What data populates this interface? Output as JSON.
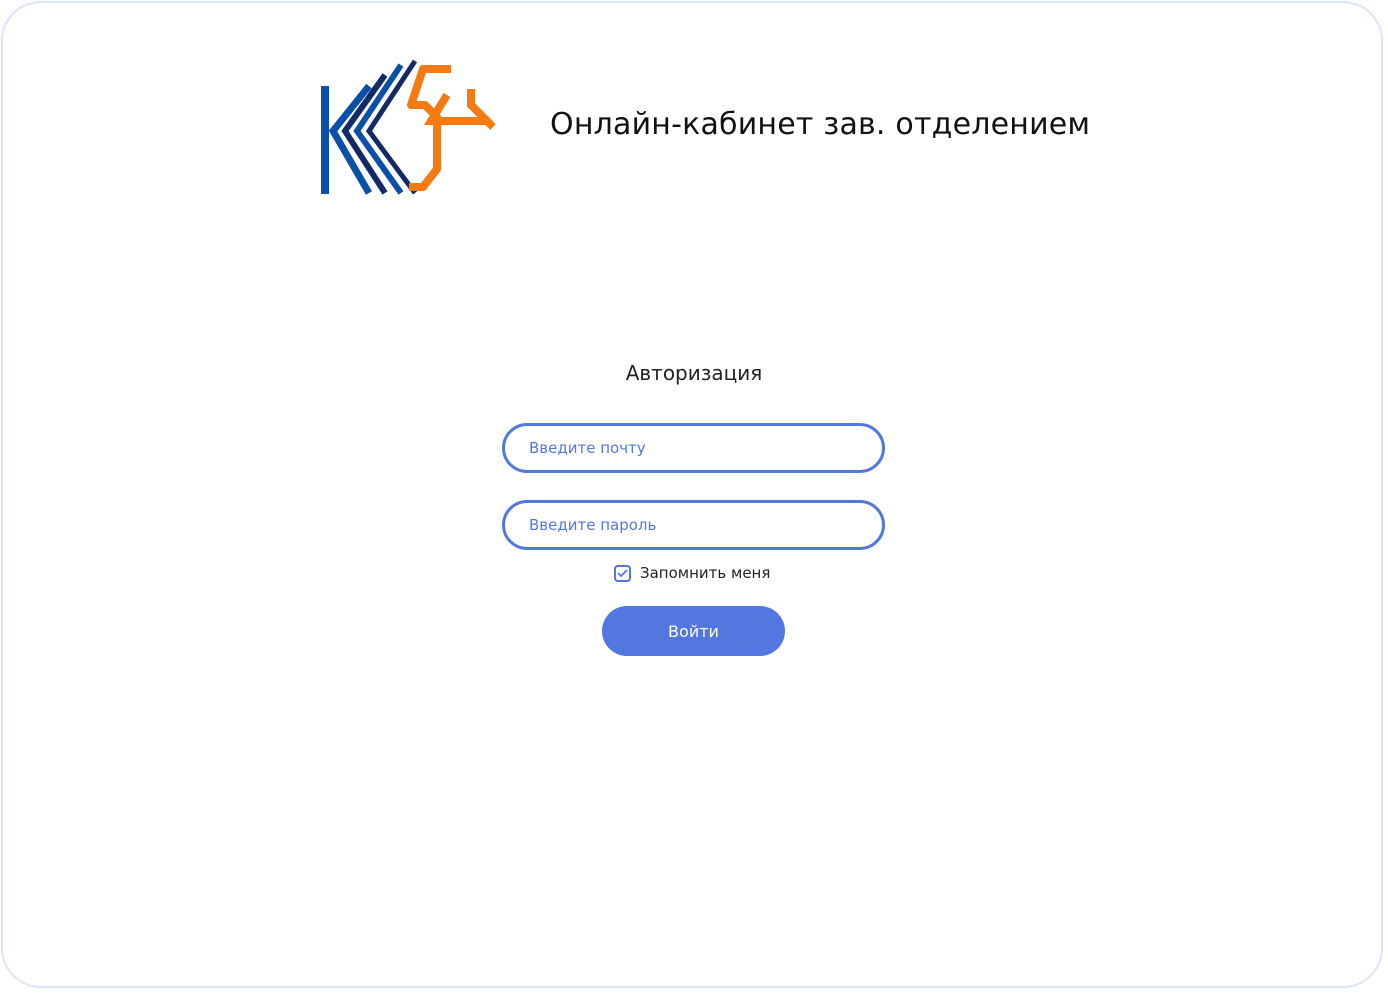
{
  "header": {
    "title": "Онлайн-кабинет зав. отделением",
    "logo_icon": "k54-logo"
  },
  "auth": {
    "heading": "Авторизация",
    "email_placeholder": "Введите почту",
    "password_placeholder": "Введите пароль",
    "remember_label": "Запомнить меня",
    "remember_checked": true,
    "submit_label": "Войти"
  },
  "colors": {
    "accent": "#5377e0",
    "logo_blue": "#0a4fa8",
    "logo_navy": "#132a66",
    "logo_orange": "#f47a12"
  }
}
